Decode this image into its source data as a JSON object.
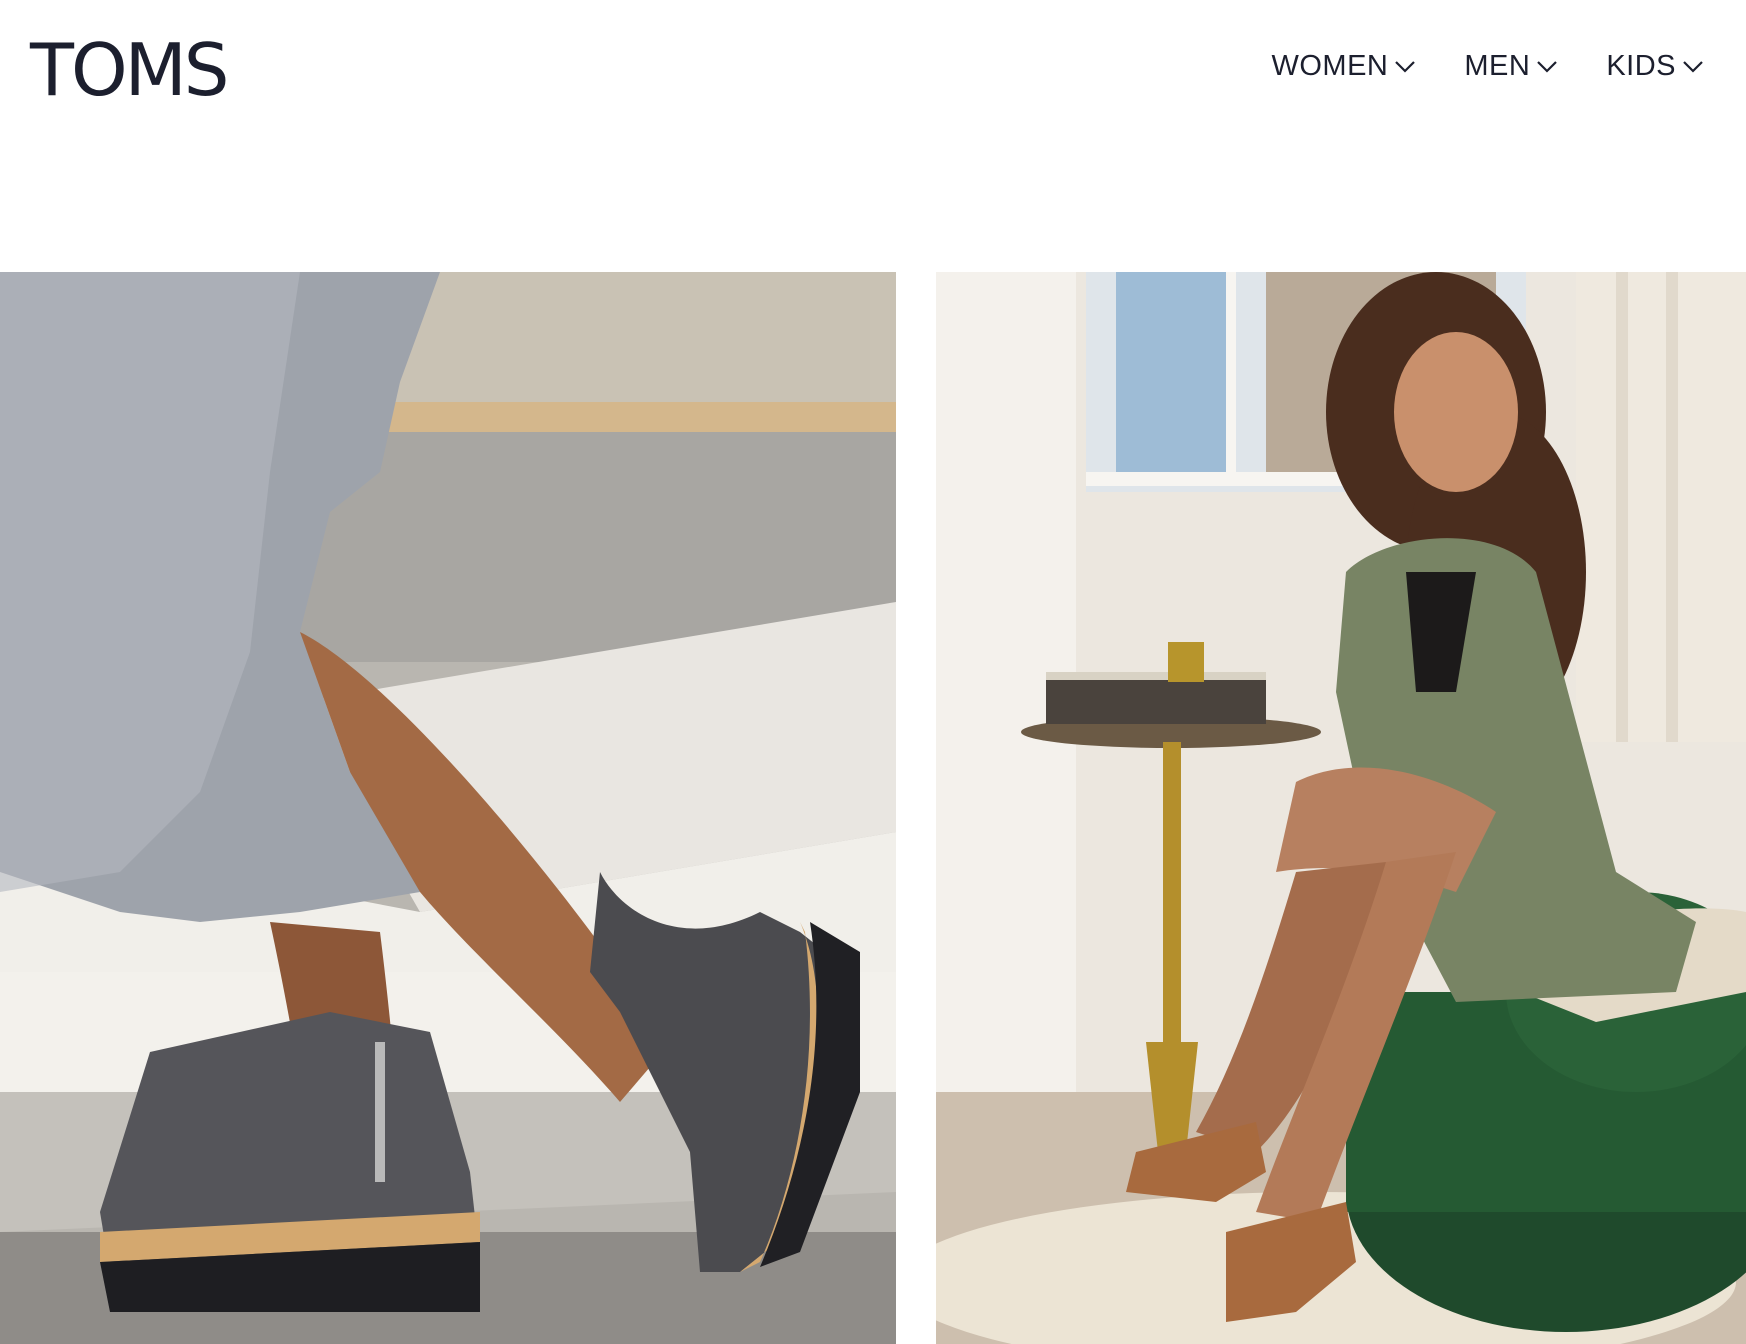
{
  "brand": {
    "logo_text": "TOMS"
  },
  "nav": {
    "items": [
      {
        "label": "WOMEN",
        "icon": "chevron-down-icon"
      },
      {
        "label": "MEN",
        "icon": "chevron-down-icon"
      },
      {
        "label": "KIDS",
        "icon": "chevron-down-icon"
      }
    ]
  },
  "hero": {
    "tiles": [
      {
        "subject": "woman walking in grey suede wedge ankle boots and a satin midi skirt"
      },
      {
        "subject": "woman seated on green velvet chair wearing brown cut-out heels and olive blazer"
      }
    ]
  },
  "colors": {
    "text": "#1c1f2e",
    "background": "#ffffff"
  }
}
